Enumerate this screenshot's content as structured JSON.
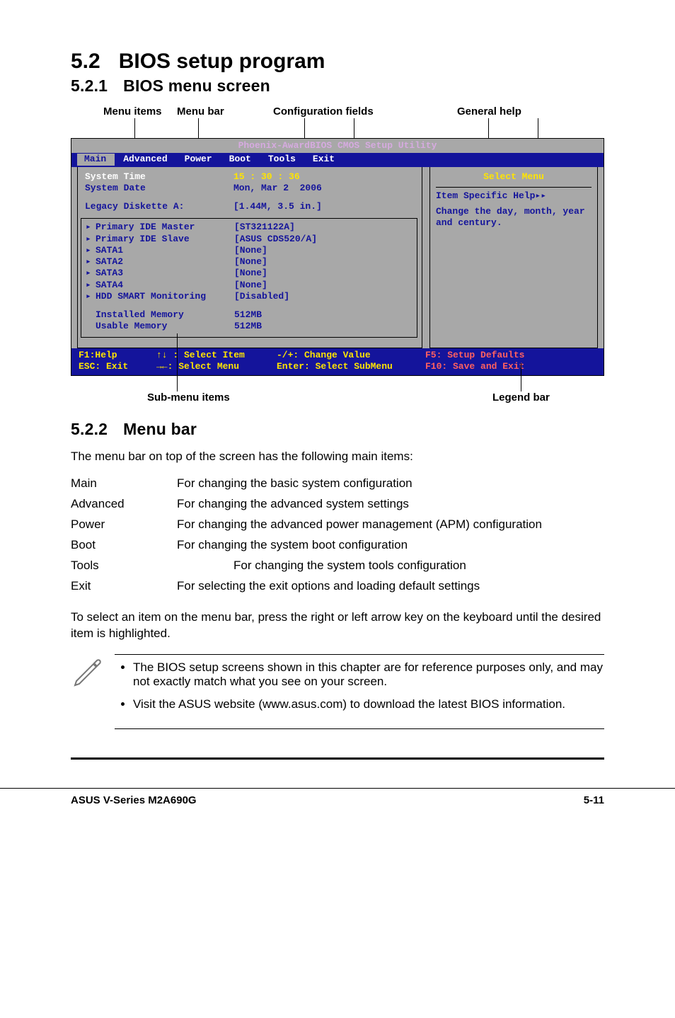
{
  "headings": {
    "h1_num": "5.2",
    "h1_title": "BIOS setup program",
    "h2a_num": "5.2.1",
    "h2a_title": "BIOS menu screen",
    "h2b_num": "5.2.2",
    "h2b_title": "Menu bar"
  },
  "annotations": {
    "menu_items": "Menu items",
    "menu_bar": "Menu bar",
    "config_fields": "Configuration fields",
    "general_help": "General help",
    "sub_menu_items": "Sub-menu items",
    "legend_bar": "Legend bar"
  },
  "bios": {
    "title": "Phoenix-AwardBIOS CMOS Setup Utility",
    "tabs": [
      "Main",
      "Advanced",
      "Power",
      "Boot",
      "Tools",
      "Exit"
    ],
    "main_items": {
      "system_time_label": "System Time",
      "system_time_value": "15 : 30 : 36",
      "system_date_label": "System Date",
      "system_date_value": "Mon, Mar 2  2006",
      "legacy_label": "Legacy Diskette A:",
      "legacy_value": "[1.44M, 3.5 in.]"
    },
    "sub_items": [
      {
        "label": "Primary IDE Master",
        "value": "[ST321122A]"
      },
      {
        "label": "Primary IDE Slave",
        "value": "[ASUS CDS520/A]"
      },
      {
        "label": "SATA1",
        "value": "[None]"
      },
      {
        "label": "SATA2",
        "value": "[None]"
      },
      {
        "label": "SATA3",
        "value": "[None]"
      },
      {
        "label": "SATA4",
        "value": "[None]"
      },
      {
        "label": "HDD SMART Monitoring",
        "value": "[Disabled]"
      }
    ],
    "memory_items": [
      {
        "label": "Installed Memory",
        "value": "512MB"
      },
      {
        "label": "Usable Memory",
        "value": "512MB"
      }
    ],
    "help": {
      "select_menu": "Select Menu",
      "item_specific": "Item Specific Help▸▸",
      "help_text": "Change the day, month, year and century."
    },
    "legend": {
      "f1": "F1:Help",
      "esc": "ESC: Exit",
      "sel_item": "↑↓ : Select Item",
      "sel_menu": "→←: Select Menu",
      "change_val": "-/+:  Change Value",
      "sel_sub": "Enter: Select SubMenu",
      "f5": "F5: Setup Defaults",
      "f10": "F10: Save and Exit"
    }
  },
  "menubar_intro": "The menu bar on top of the screen has the following main items:",
  "menubar_defs": [
    {
      "term": "Main",
      "desc": "For changing the basic system configuration"
    },
    {
      "term": "Advanced",
      "desc": "For changing the advanced system settings"
    },
    {
      "term": "Power",
      "desc": "For changing the advanced power management (APM) configuration"
    },
    {
      "term": "Boot",
      "desc": "For changing the system boot configuration"
    },
    {
      "term": "Tools",
      "desc": "For changing the system tools configuration"
    },
    {
      "term": "Exit",
      "desc": "For selecting the exit options and loading default settings"
    }
  ],
  "select_para": "To select an item on the menu bar, press the right or left arrow key on the keyboard until the desired item is highlighted.",
  "notes": [
    "The BIOS setup screens shown in this chapter are for reference purposes only, and may not exactly match what you see on your screen.",
    "Visit the ASUS website (www.asus.com) to download the latest BIOS information."
  ],
  "footer": {
    "left": "ASUS V-Series M2A690G",
    "right": "5-11"
  }
}
